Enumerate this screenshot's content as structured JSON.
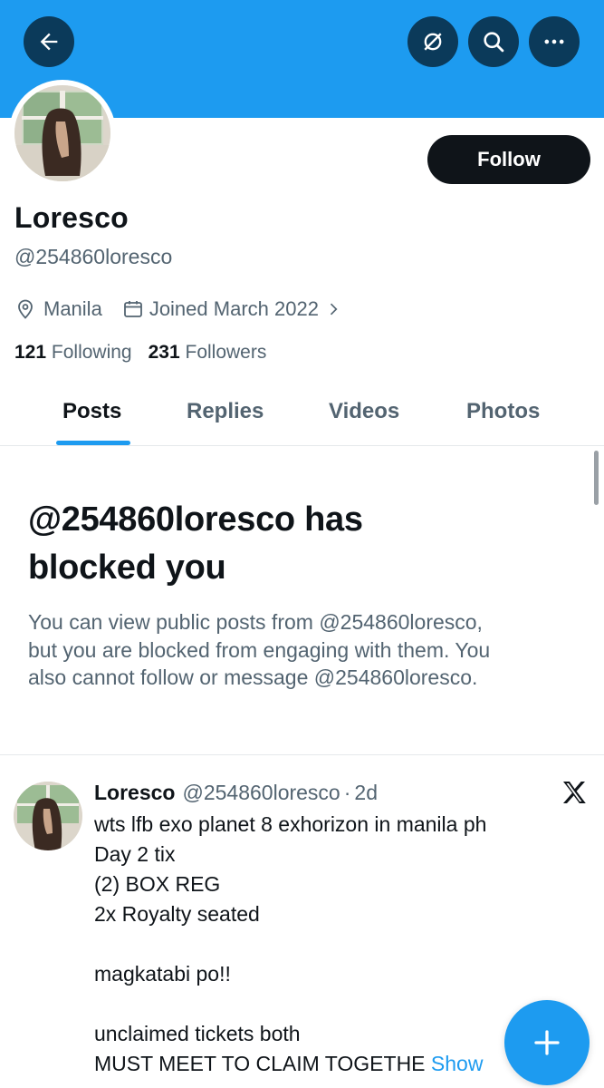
{
  "header": {
    "back_icon": "arrow-left-icon",
    "grok_icon": "grok-icon",
    "search_icon": "search-icon",
    "more_icon": "more-horizontal-icon",
    "banner_color": "#1d9bf0"
  },
  "profile": {
    "name": "Loresco",
    "handle": "@254860loresco",
    "location": "Manila",
    "joined": "Joined March 2022",
    "following_count": "121",
    "following_label": "Following",
    "followers_count": "231",
    "followers_label": "Followers",
    "follow_label": "Follow"
  },
  "tabs": [
    {
      "label": "Posts",
      "active": true
    },
    {
      "label": "Replies",
      "active": false
    },
    {
      "label": "Videos",
      "active": false
    },
    {
      "label": "Photos",
      "active": false
    }
  ],
  "blocked": {
    "title_line1": "@254860loresco has",
    "title_line2": "blocked you",
    "desc_line1": "You can view public posts from @254860loresco,",
    "desc_line2": "but you are blocked from engaging with them. You",
    "desc_line3": "also cannot follow or message @254860loresco."
  },
  "post": {
    "name": "Loresco",
    "handle": "@254860loresco",
    "separator": "·",
    "time": "2d",
    "lines": [
      "wts lfb exo planet 8 exhorizon in manila ph",
      "Day 2 tix",
      "(2) BOX REG",
      "2x Royalty seated",
      "",
      "magkatabi po!!",
      "",
      "unclaimed tickets both",
      "MUST MEET TO CLAIM TOGETHE"
    ],
    "show_more": "Show",
    "platform_icon": "x-logo-icon"
  },
  "fab": {
    "icon": "plus-icon"
  },
  "colors": {
    "accent": "#1d9bf0",
    "text": "#0f1419",
    "muted": "#536471",
    "dark_button": "#0f1419"
  }
}
